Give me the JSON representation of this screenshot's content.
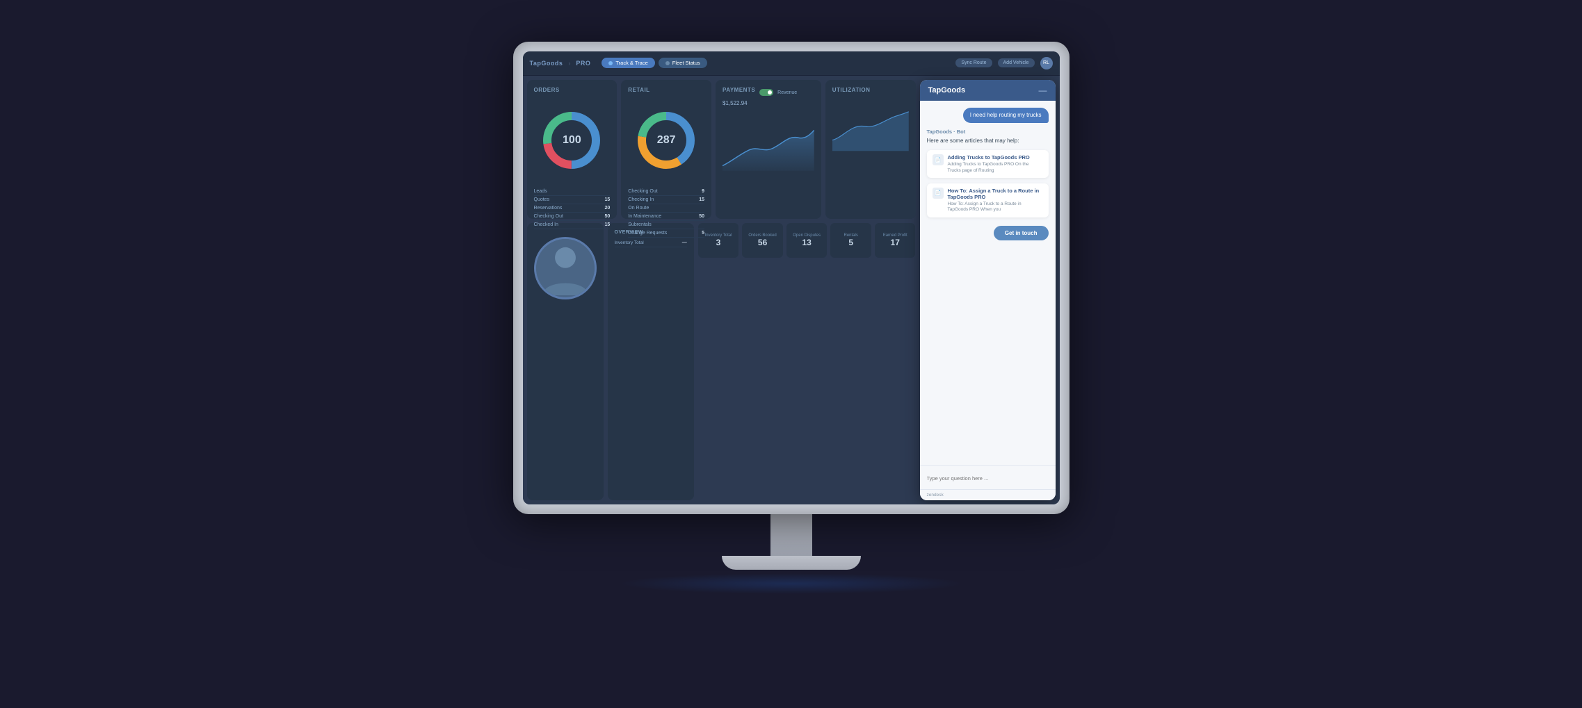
{
  "monitor": {
    "nav": {
      "logo": "TapGoods",
      "subtitle": "PRO",
      "tabs": [
        {
          "label": "Track & Trace",
          "active": true
        },
        {
          "label": "Fleet Status",
          "active": false
        }
      ],
      "buttons": [
        "Sync Route",
        "Add Vehicle"
      ],
      "avatar_initials": "RL"
    },
    "dashboard": {
      "cards": [
        {
          "title": "Orders",
          "donut_value": "100",
          "donut_color_main": "#4a8fcf",
          "donut_color_secondary": "#e05060",
          "donut_color_tertiary": "#4aba8a",
          "list_items": [
            {
              "label": "Leads",
              "value": ""
            },
            {
              "label": "Quotes",
              "value": "15"
            },
            {
              "label": "Reservations",
              "value": "20"
            },
            {
              "label": "Checking Out",
              "value": "50"
            },
            {
              "label": "Checked In",
              "value": "15"
            }
          ]
        },
        {
          "title": "Retail",
          "donut_value": "287",
          "donut_color_main": "#4a8fcf",
          "donut_color_secondary": "#f0a030",
          "donut_color_tertiary": "#4aba8a",
          "list_items": [
            {
              "label": "Checking Out",
              "value": "9"
            },
            {
              "label": "Checking In",
              "value": "15"
            },
            {
              "label": "On Route",
              "value": ""
            },
            {
              "label": "In Maintenance",
              "value": "50"
            },
            {
              "label": "Subrentals",
              "value": ""
            },
            {
              "label": "Change Requests",
              "value": "5"
            }
          ]
        },
        {
          "title": "Payments",
          "has_toggle": true,
          "toggle_label": "Revenue",
          "area_chart": true,
          "payment_value": "$1,522.94"
        },
        {
          "title": "Utilization"
        }
      ],
      "metrics": [
        {
          "label": "Inventory Total",
          "value": "3"
        },
        {
          "label": "Orders Booked",
          "value": "56"
        },
        {
          "label": "Open Disputes",
          "value": "13"
        },
        {
          "label": "Rentals",
          "value": "5"
        },
        {
          "label": "Earned Profit",
          "value": "17"
        }
      ]
    },
    "chat": {
      "header_title": "TapGoods",
      "close_label": "—",
      "user_message": "I need help routing my trucks",
      "bot_label": "TapGoods · Bot",
      "bot_intro": "Here are some articles that may help:",
      "articles": [
        {
          "title": "Adding Trucks to TapGoods PRO",
          "description": "Adding Trucks to TapGoods PRO On the Trucks page of Routing"
        },
        {
          "title": "How To: Assign a Truck to a Route in TapGoods PRO",
          "description": "How To: Assign a Truck to a Route in TapGoods PRO When you"
        }
      ],
      "get_touch_label": "Get in touch",
      "input_placeholder": "Type your question here ...",
      "footer_label": "zendesk"
    }
  }
}
